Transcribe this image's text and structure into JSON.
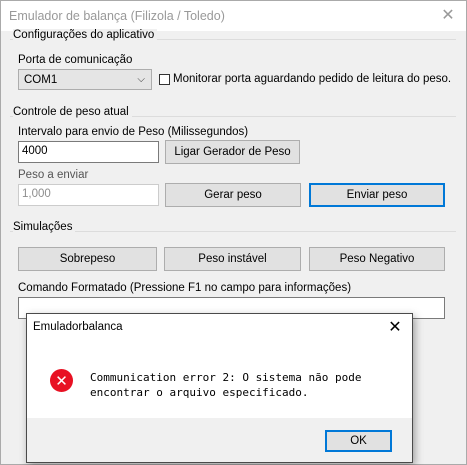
{
  "window": {
    "title": "Emulador de balança (Filizola / Toledo)",
    "close_glyph": "✕"
  },
  "config": {
    "group_label": "Configurações do aplicativo",
    "port_label": "Porta de comunicação",
    "port_value": "COM1",
    "monitor_label": "Monitorar porta aguardando pedido de leitura do peso."
  },
  "weight": {
    "group_label": "Controle de peso atual",
    "interval_label": "Intervalo para envio de Peso (Milissegundos)",
    "interval_value": "4000",
    "generator_button": "Ligar Gerador de Peso",
    "send_label": "Peso a enviar",
    "send_value": "1,000",
    "generate_button": "Gerar peso",
    "send_button": "Enviar peso"
  },
  "simulations": {
    "group_label": "Simulações",
    "overweight_button": "Sobrepeso",
    "unstable_button": "Peso instável",
    "negative_button": "Peso Negativo",
    "command_label": "Comando Formatado (Pressione F1 no campo para informações)",
    "command_value": ""
  },
  "dialog": {
    "title": "Emuladorbalanca",
    "close_glyph": "✕",
    "icon": "error-icon",
    "icon_glyph": "✕",
    "message": "Communication error 2: O sistema não pode encontrar o arquivo especificado.",
    "ok_button": "OK"
  },
  "colors": {
    "accent": "#0078d7",
    "error": "#e81123"
  }
}
